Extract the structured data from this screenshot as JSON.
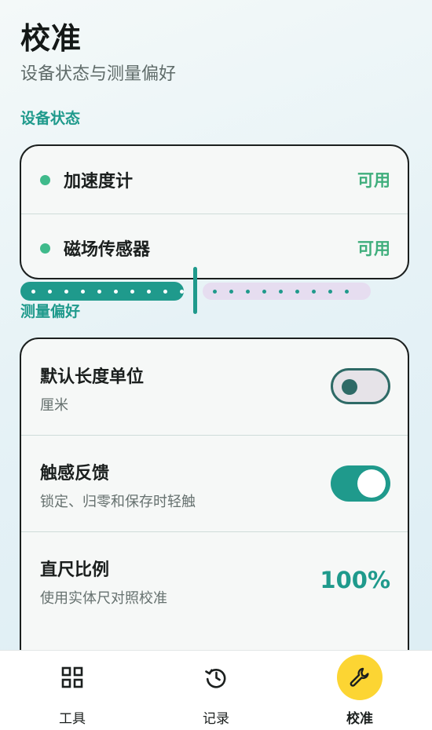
{
  "header": {
    "title": "校准",
    "subtitle": "设备状态与测量偏好"
  },
  "device_status": {
    "section_label": "设备状态",
    "items": [
      {
        "name": "加速度计",
        "status": "可用"
      },
      {
        "name": "磁场传感器",
        "status": "可用"
      }
    ]
  },
  "preferences": {
    "section_label": "测量偏好",
    "default_unit": {
      "title": "默认长度单位",
      "value": "厘米",
      "toggle_on": false
    },
    "haptics": {
      "title": "触感反馈",
      "description": "锁定、归零和保存时轻触",
      "toggle_on": true
    },
    "ruler_scale": {
      "title": "直尺比例",
      "description": "使用实体尺对照校准",
      "value_label": "100%",
      "fraction": 0.5
    }
  },
  "bottom_nav": {
    "items": [
      {
        "label": "工具",
        "icon": "grid-icon",
        "active": false
      },
      {
        "label": "记录",
        "icon": "history-icon",
        "active": false
      },
      {
        "label": "校准",
        "icon": "wrench-icon",
        "active": true
      }
    ]
  },
  "colors": {
    "accent": "#1f9a8c",
    "available": "#3fae7c",
    "nav_active": "#fcd533"
  }
}
